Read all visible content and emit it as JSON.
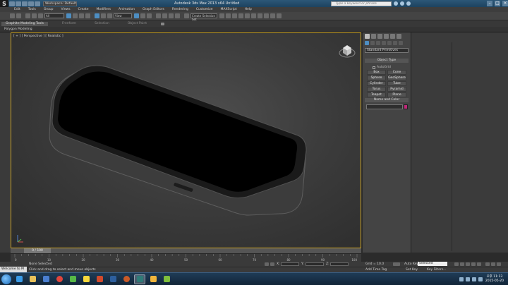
{
  "titlebar": {
    "workspace": "Workspace: Default",
    "title": "Autodesk 3ds Max 2013 x64     Untitled",
    "search_placeholder": "Type a keyword or phrase"
  },
  "menu": [
    "Edit",
    "Tools",
    "Group",
    "Views",
    "Create",
    "Modifiers",
    "Animation",
    "Graph Editors",
    "Rendering",
    "Customize",
    "MAXScript",
    "Help"
  ],
  "toolbar": {
    "filter": "All",
    "coord": "View",
    "selection_set": "Create Selection Set"
  },
  "ribbon": {
    "tabs": [
      "Graphite Modeling Tools",
      "Freeform",
      "Selection",
      "Object Paint"
    ],
    "sub_label": "Polygon Modeling"
  },
  "viewport": {
    "label": "[ + ] [ Perspective ] [ Realistic ]"
  },
  "command_panel": {
    "category": "Standard Primitives",
    "object_type_title": "Object Type",
    "autogrid": "AutoGrid",
    "primitives": [
      "Box",
      "Cone",
      "Sphere",
      "GeoSphere",
      "Cylinder",
      "Tube",
      "Torus",
      "Pyramid",
      "Teapot",
      "Plane"
    ],
    "name_color_title": "Name and Color",
    "object_color": "#c0287a"
  },
  "timeline": {
    "slider_text": "0 / 100",
    "ticks": [
      "0",
      "10",
      "20",
      "30",
      "40",
      "50",
      "60",
      "70",
      "80",
      "90",
      "100"
    ]
  },
  "status": {
    "selection": "None Selected",
    "prompt": "Click and drag to select and move objects",
    "listener": "Welcome to M",
    "x_label": "X:",
    "y_label": "Y:",
    "z_label": "Z:",
    "grid": "Grid = 10.0",
    "add_time_tag": "Add Time Tag",
    "auto_key": "Auto Key",
    "set_key": "Set Key",
    "key_filters": "Key Filters...",
    "selected": "Selected"
  },
  "taskbar": {
    "time": "오후 11:13",
    "date": "2015-05-20"
  }
}
